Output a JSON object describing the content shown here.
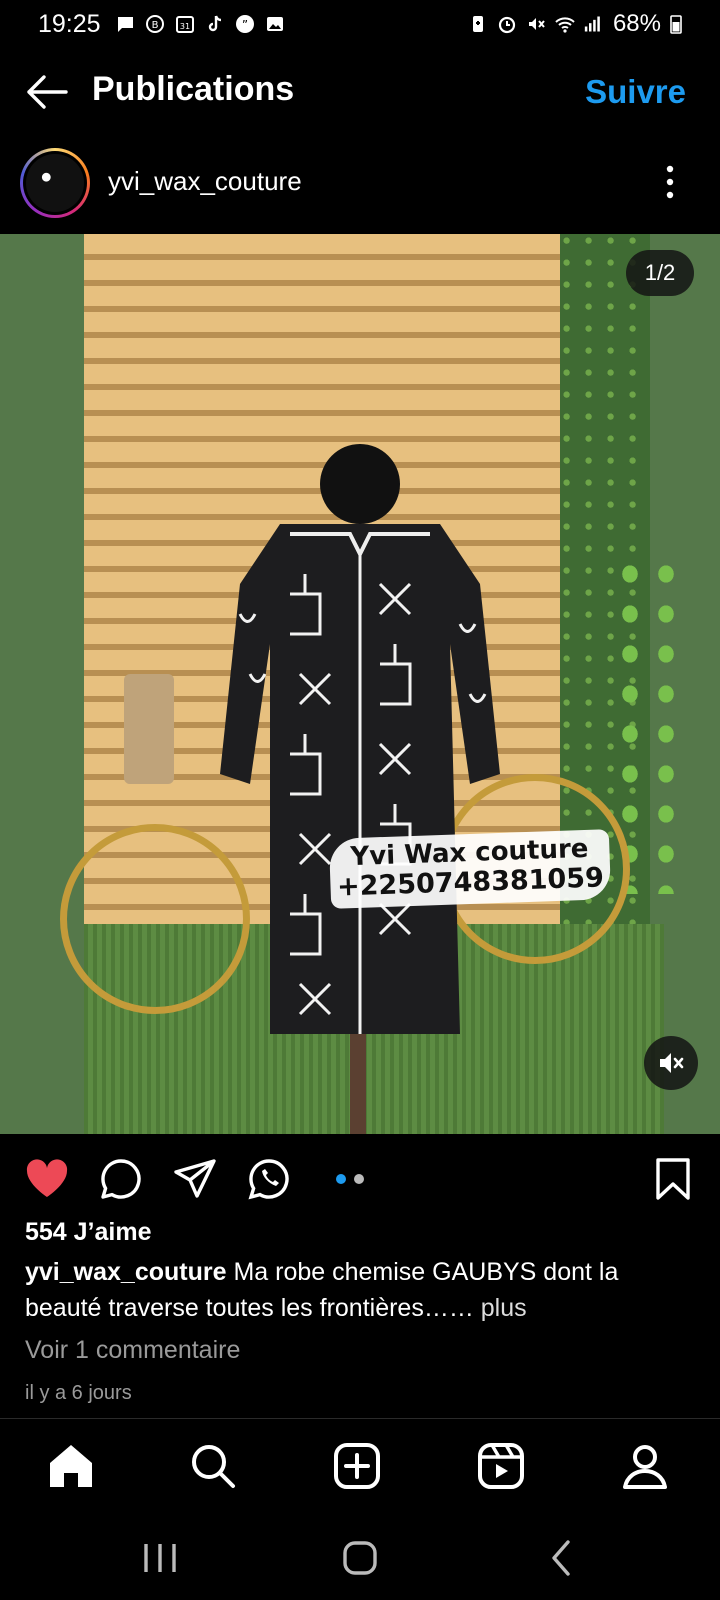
{
  "status_bar": {
    "time": "19:25",
    "battery": "68%",
    "icons": [
      "message-icon",
      "bixby-icon",
      "calendar-icon",
      "tiktok-icon",
      "quote-icon",
      "gallery-icon",
      "battery-saver-icon",
      "alarm-icon",
      "mute-icon",
      "wifi-icon",
      "signal-icon",
      "battery-icon"
    ]
  },
  "header": {
    "title": "Publications",
    "follow_label": "Suivre"
  },
  "post": {
    "username": "yvi_wax_couture",
    "media_counter": "1/2",
    "watermark_line1": "Yvi Wax couture",
    "watermark_line2": "+2250748381059",
    "likes": "554 J’aime",
    "caption_user": "yvi_wax_couture",
    "caption_text": "Ma robe chemise GAUBYS dont la beauté traverse toutes les frontières…… ",
    "caption_more": "plus",
    "comments": "Voir 1 commentaire",
    "date": "il y a 6 jours",
    "carousel": {
      "count": 2,
      "active": 1
    }
  },
  "colors": {
    "accent": "#1d9bf0",
    "like": "#ed4956",
    "background": "#000000"
  },
  "bottom_nav": [
    "home-icon",
    "search-icon",
    "create-icon",
    "reels-icon",
    "profile-icon"
  ],
  "system_nav": [
    "recents-icon",
    "home-system-icon",
    "back-system-icon"
  ]
}
